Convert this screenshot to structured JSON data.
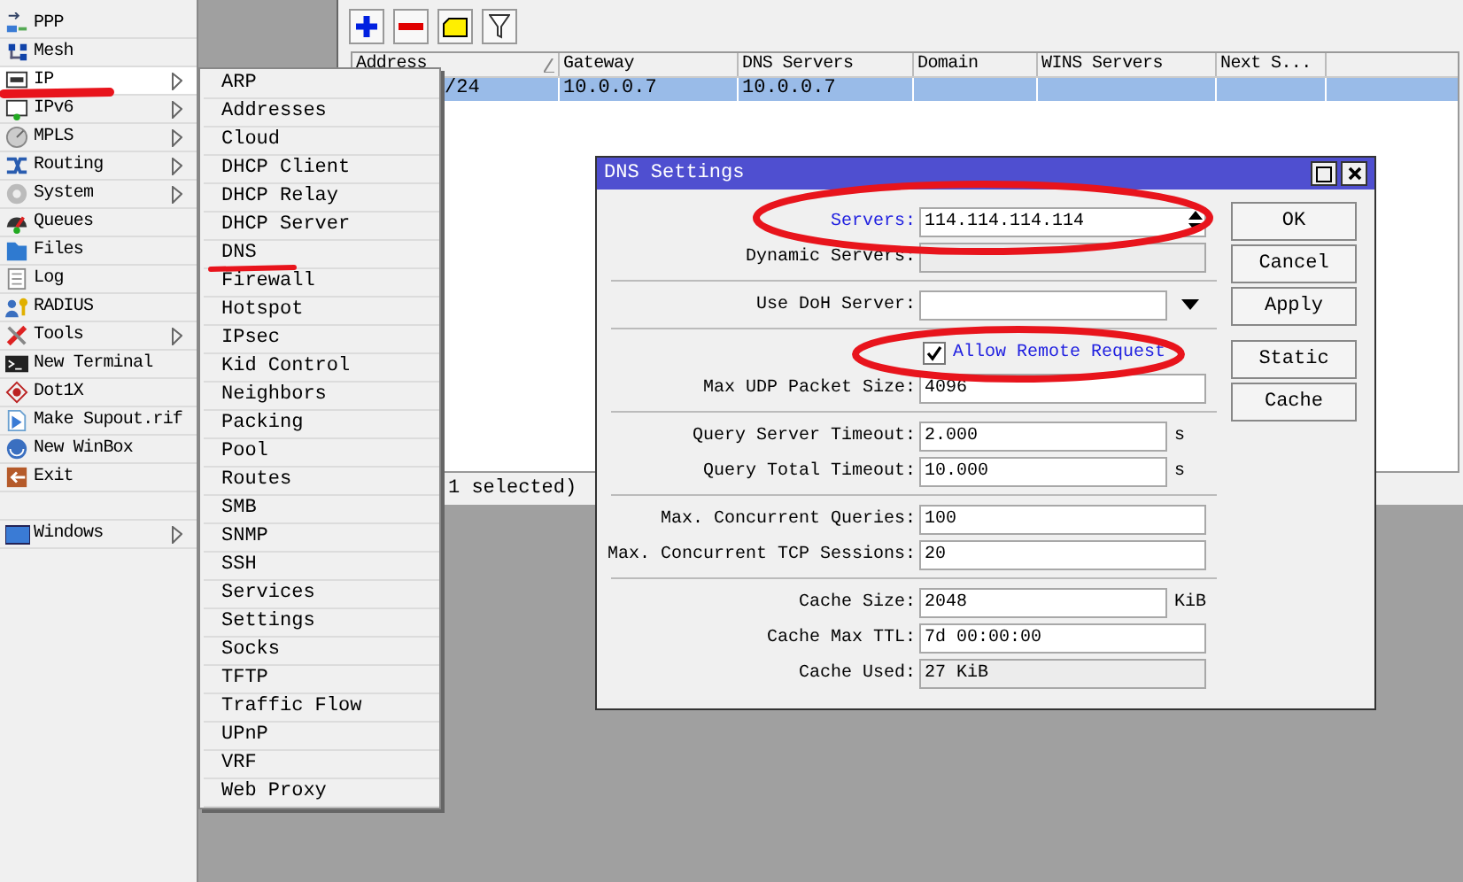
{
  "sidebar": {
    "items": [
      {
        "label": "PPP",
        "has_submenu": false,
        "selected": false
      },
      {
        "label": "Mesh",
        "has_submenu": false,
        "selected": false
      },
      {
        "label": "IP",
        "has_submenu": true,
        "selected": true
      },
      {
        "label": "IPv6",
        "has_submenu": true,
        "selected": false
      },
      {
        "label": "MPLS",
        "has_submenu": true,
        "selected": false
      },
      {
        "label": "Routing",
        "has_submenu": true,
        "selected": false
      },
      {
        "label": "System",
        "has_submenu": true,
        "selected": false
      },
      {
        "label": "Queues",
        "has_submenu": false,
        "selected": false
      },
      {
        "label": "Files",
        "has_submenu": false,
        "selected": false
      },
      {
        "label": "Log",
        "has_submenu": false,
        "selected": false
      },
      {
        "label": "RADIUS",
        "has_submenu": false,
        "selected": false
      },
      {
        "label": "Tools",
        "has_submenu": true,
        "selected": false
      },
      {
        "label": "New Terminal",
        "has_submenu": false,
        "selected": false
      },
      {
        "label": "Dot1X",
        "has_submenu": false,
        "selected": false
      },
      {
        "label": "Make Supout.rif",
        "has_submenu": false,
        "selected": false
      },
      {
        "label": "New WinBox",
        "has_submenu": false,
        "selected": false
      },
      {
        "label": "Exit",
        "has_submenu": false,
        "selected": false
      }
    ],
    "bottom_items": [
      {
        "label": "Windows",
        "has_submenu": true,
        "selected": false
      }
    ]
  },
  "ip_submenu": {
    "items": [
      "ARP",
      "Addresses",
      "Cloud",
      "DHCP Client",
      "DHCP Relay",
      "DHCP Server",
      "DNS",
      "Firewall",
      "Hotspot",
      "IPsec",
      "Kid Control",
      "Neighbors",
      "Packing",
      "Pool",
      "Routes",
      "SMB",
      "SNMP",
      "SSH",
      "Services",
      "Settings",
      "Socks",
      "TFTP",
      "Traffic Flow",
      "UPnP",
      "VRF",
      "Web Proxy"
    ]
  },
  "table": {
    "columns": [
      {
        "label": "Address",
        "sorted": true
      },
      {
        "label": "Gateway",
        "sorted": false
      },
      {
        "label": "DNS Servers",
        "sorted": false
      },
      {
        "label": "Domain",
        "sorted": false
      },
      {
        "label": "WINS Servers",
        "sorted": false
      },
      {
        "label": "Next S...",
        "sorted": false
      }
    ],
    "rows": [
      {
        "cells": [
          "/24",
          "10.0.0.7",
          "10.0.0.7"
        ],
        "selected": true
      }
    ]
  },
  "status_bar": "1 selected)",
  "dialog": {
    "title": "DNS Settings",
    "sections": [
      [
        {
          "kind": "spinner",
          "label": "Servers:",
          "value": "114.114.114.114",
          "modified": true
        },
        {
          "kind": "readonly",
          "label": "Dynamic Servers:",
          "modified": false
        }
      ],
      [
        {
          "kind": "dropdown",
          "label": "Use DoH Server:",
          "modified": false
        }
      ],
      [
        {
          "kind": "checkbox",
          "label": "Allow Remote Request",
          "checked": true,
          "modified": true
        },
        {
          "kind": "input",
          "label": "Max UDP Packet Size:",
          "value": "4096",
          "modified": false
        }
      ],
      [
        {
          "kind": "input",
          "label": "Query Server Timeout:",
          "value": "2.000",
          "unit": "s",
          "modified": false
        },
        {
          "kind": "input",
          "label": "Query Total Timeout:",
          "value": "10.000",
          "unit": "s",
          "modified": false
        }
      ],
      [
        {
          "kind": "input",
          "label": "Max. Concurrent Queries:",
          "value": "100",
          "modified": false
        },
        {
          "kind": "input",
          "label": "Max. Concurrent TCP Sessions:",
          "value": "20",
          "modified": false
        }
      ],
      [
        {
          "kind": "input",
          "label": "Cache Size:",
          "value": "2048",
          "unit": "KiB",
          "modified": false
        },
        {
          "kind": "input",
          "label": "Cache Max TTL:",
          "value": "7d 00:00:00",
          "modified": false
        },
        {
          "kind": "readonly",
          "label": "Cache Used:",
          "value": "27 KiB",
          "modified": false
        }
      ]
    ],
    "buttons": [
      [
        "OK",
        "Cancel",
        "Apply"
      ],
      [
        "Static",
        "Cache"
      ]
    ]
  }
}
